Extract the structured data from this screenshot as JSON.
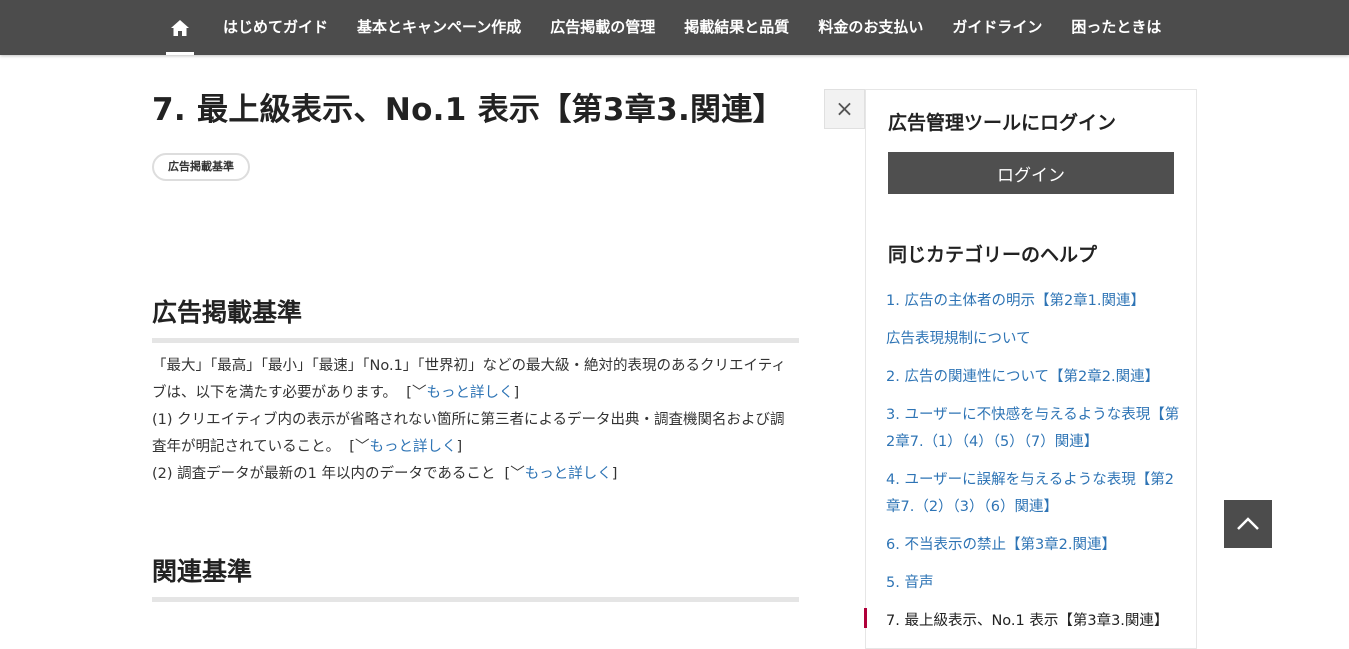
{
  "nav": {
    "home_icon": "home-icon",
    "items": [
      "はじめてガイド",
      "基本とキャンペーン作成",
      "広告掲載の管理",
      "掲載結果と品質",
      "料金のお支払い",
      "ガイドライン",
      "困ったときは"
    ]
  },
  "article": {
    "title": "7. 最上級表示、No.1 表示【第3章3.関連】",
    "tag": "広告掲載基準",
    "section1": {
      "heading": "広告掲載基準",
      "intro": "「最大」「最高」「最小」「最速」「No.1」「世界初」などの最大級・絶対的表現のあるクリエイティブは、以下を満たす必要があります。",
      "item1": "(1) クリエイティブ内の表示が省略されない箇所に第三者によるデータ出典・調査機関名および調査年が明記されていること。",
      "item2": "(2) 調査データが最新の1 年以内のデータであること",
      "more_label": "もっと詳しく"
    },
    "section2": {
      "heading": "関連基準"
    }
  },
  "sidebar": {
    "close_icon": "close-icon",
    "close_glyph": "×",
    "login_heading": "広告管理ツールにログイン",
    "login_button": "ログイン",
    "category_heading": "同じカテゴリーのヘルプ",
    "links": [
      "1. 広告の主体者の明示【第2章1.関連】",
      "広告表現規制について",
      "2. 広告の関連性について【第2章2.関連】",
      "3. ユーザーに不快感を与えるような表現【第2章7.（1）（4）（5）（7）関連】",
      "4. ユーザーに誤解を与えるような表現【第2章7.（2）（3）（6）関連】",
      "6. 不当表示の禁止【第3章2.関連】",
      "5. 音声",
      "7. 最上級表示、No.1 表示【第3章3.関連】"
    ]
  },
  "scroll_top_icon": "chevron-up-icon",
  "colors": {
    "nav_bg": "#4c4c4c",
    "link": "#2e74b5",
    "login_button_bg": "#4f4f4f",
    "current_marker": "#b0003a"
  }
}
